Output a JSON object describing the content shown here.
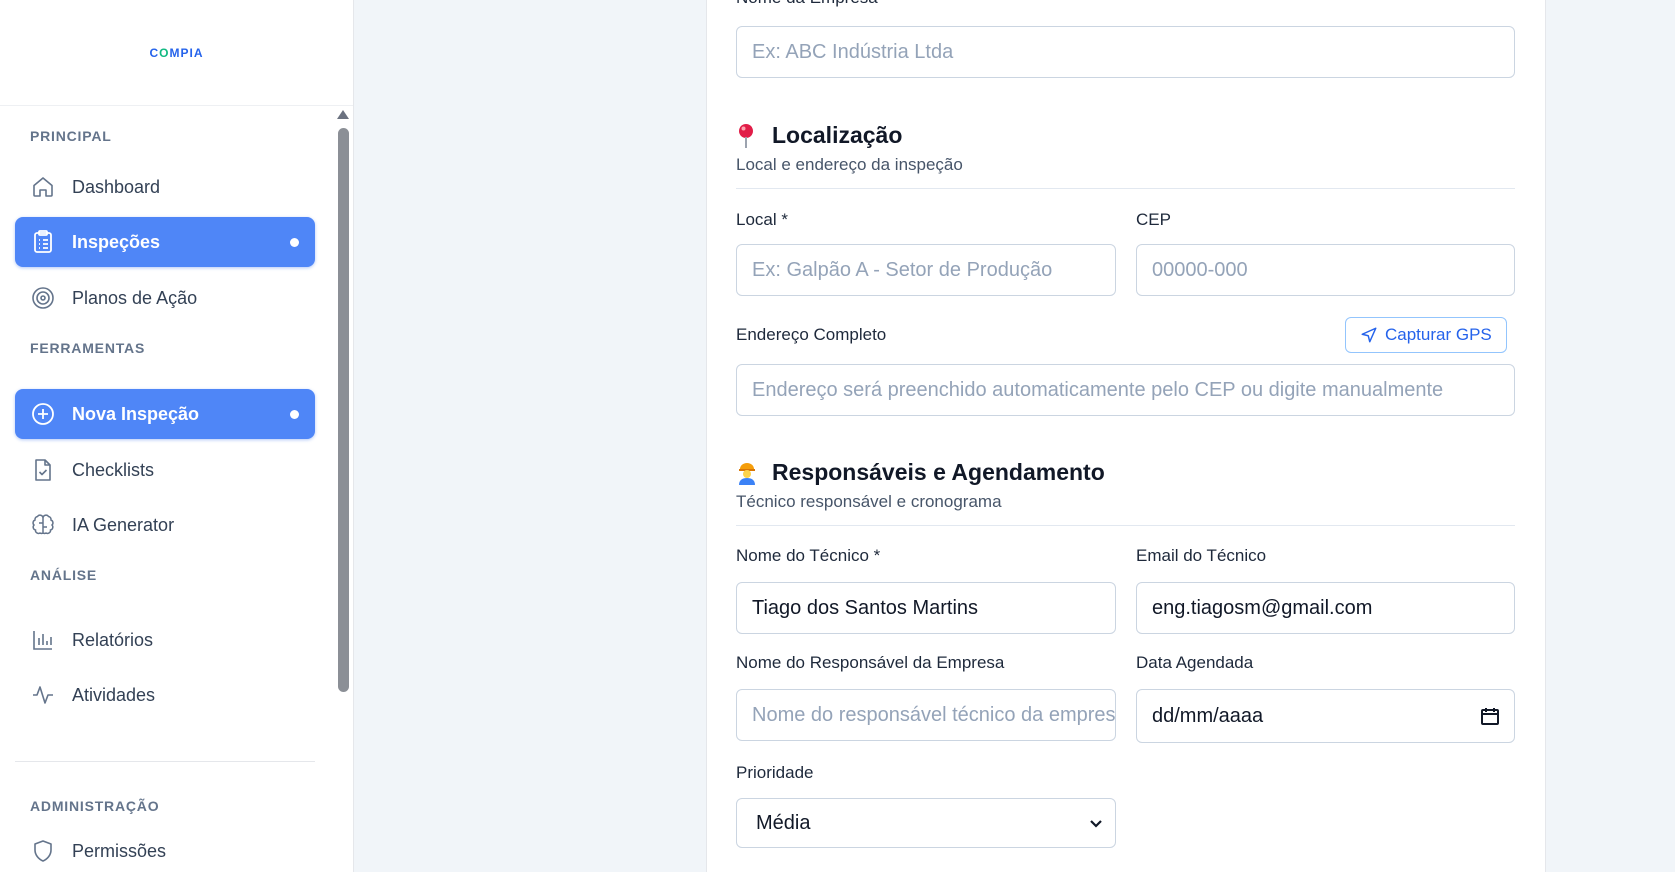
{
  "brand": {
    "logo_text_a": "C",
    "logo_text_o": "O",
    "logo_text_b": "MPIA"
  },
  "sidebar": {
    "sections": {
      "principal": "PRINCIPAL",
      "ferramentas": "FERRAMENTAS",
      "analise": "ANÁLISE",
      "administracao": "ADMINISTRAÇÃO"
    },
    "items": {
      "dashboard": "Dashboard",
      "inspecoes": "Inspeções",
      "planos": "Planos de Ação",
      "nova_inspecao": "Nova Inspeção",
      "checklists": "Checklists",
      "ia_generator": "IA Generator",
      "relatorios": "Relatórios",
      "atividades": "Atividades",
      "permissoes": "Permissões"
    },
    "active_color": "#4f86f7"
  },
  "form": {
    "empresa": {
      "label": "Nome da Empresa *",
      "placeholder": "Ex: ABC Indústria Ltda"
    },
    "localizacao": {
      "title": "Localização",
      "subtitle": "Local e endereço da inspeção",
      "local": {
        "label": "Local *",
        "placeholder": "Ex: Galpão A - Setor de Produção"
      },
      "cep": {
        "label": "CEP",
        "placeholder": "00000-000"
      },
      "endereco": {
        "label": "Endereço Completo",
        "placeholder": "Endereço será preenchido automaticamente pelo CEP ou digite manualmente"
      },
      "gps_button": "Capturar GPS"
    },
    "responsaveis": {
      "title": "Responsáveis e Agendamento",
      "subtitle": "Técnico responsável e cronograma",
      "tecnico": {
        "label": "Nome do Técnico *",
        "value": "Tiago dos Santos Martins"
      },
      "email": {
        "label": "Email do Técnico",
        "value": "eng.tiagosm@gmail.com"
      },
      "resp_empresa": {
        "label": "Nome do Responsável da Empresa",
        "placeholder": "Nome do responsável técnico da empresa"
      },
      "data": {
        "label": "Data Agendada",
        "value": "dd/mm/aaaa"
      },
      "prioridade": {
        "label": "Prioridade",
        "value": "Média"
      }
    }
  }
}
